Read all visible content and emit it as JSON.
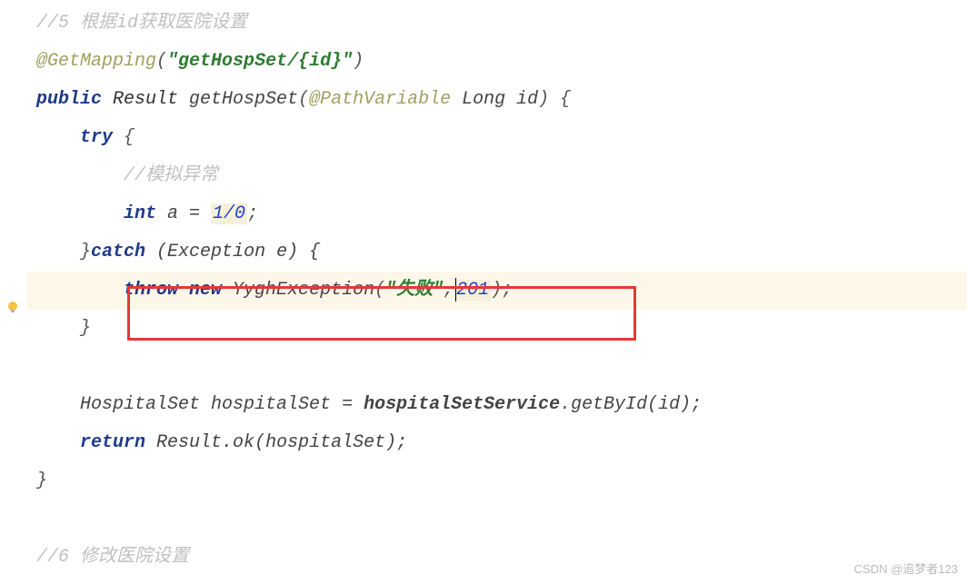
{
  "code": {
    "line1_comment": "//5 根据id获取医院设置",
    "line2_anno": "@GetMapping",
    "line2_paren_open": "(",
    "line2_str": "\"getHospSet/{id}\"",
    "line2_paren_close": ")",
    "line3_kw1": "public",
    "line3_type": " Result ",
    "line3_method": "getHospSet",
    "line3_paren": "(",
    "line3_anno": "@PathVariable",
    "line3_param": " Long id",
    "line3_close": ") {",
    "line4_kw": "try",
    "line4_brace": " {",
    "line5_comment": "//模拟异常",
    "line6_kw": "int",
    "line6_var": " a = ",
    "line6_expr": "1/0",
    "line6_semi": ";",
    "line7_close": "}",
    "line7_kw": "catch",
    "line7_param": " (Exception e) {",
    "line8_kw1": "throw",
    "line8_kw2": " new",
    "line8_exc": " YyghException",
    "line8_open": "(",
    "line8_str": "\"失败\"",
    "line8_comma": ",",
    "line8_num": "201",
    "line8_close": ");",
    "line9_brace": "}",
    "line11_stmt_a": "HospitalSet hospitalSet = ",
    "line11_svc": "hospitalSetService",
    "line11_dot": ".",
    "line11_call": "getById(id);",
    "line12_kw": "return",
    "line12_cls": " Result.",
    "line12_ok": "ok",
    "line12_arg": "(hospitalSet);",
    "line13_brace": "}",
    "line15_comment": "//6 修改医院设置"
  },
  "icons": {
    "bulb": "lightbulb-icon"
  },
  "watermark": "CSDN @追梦者123"
}
